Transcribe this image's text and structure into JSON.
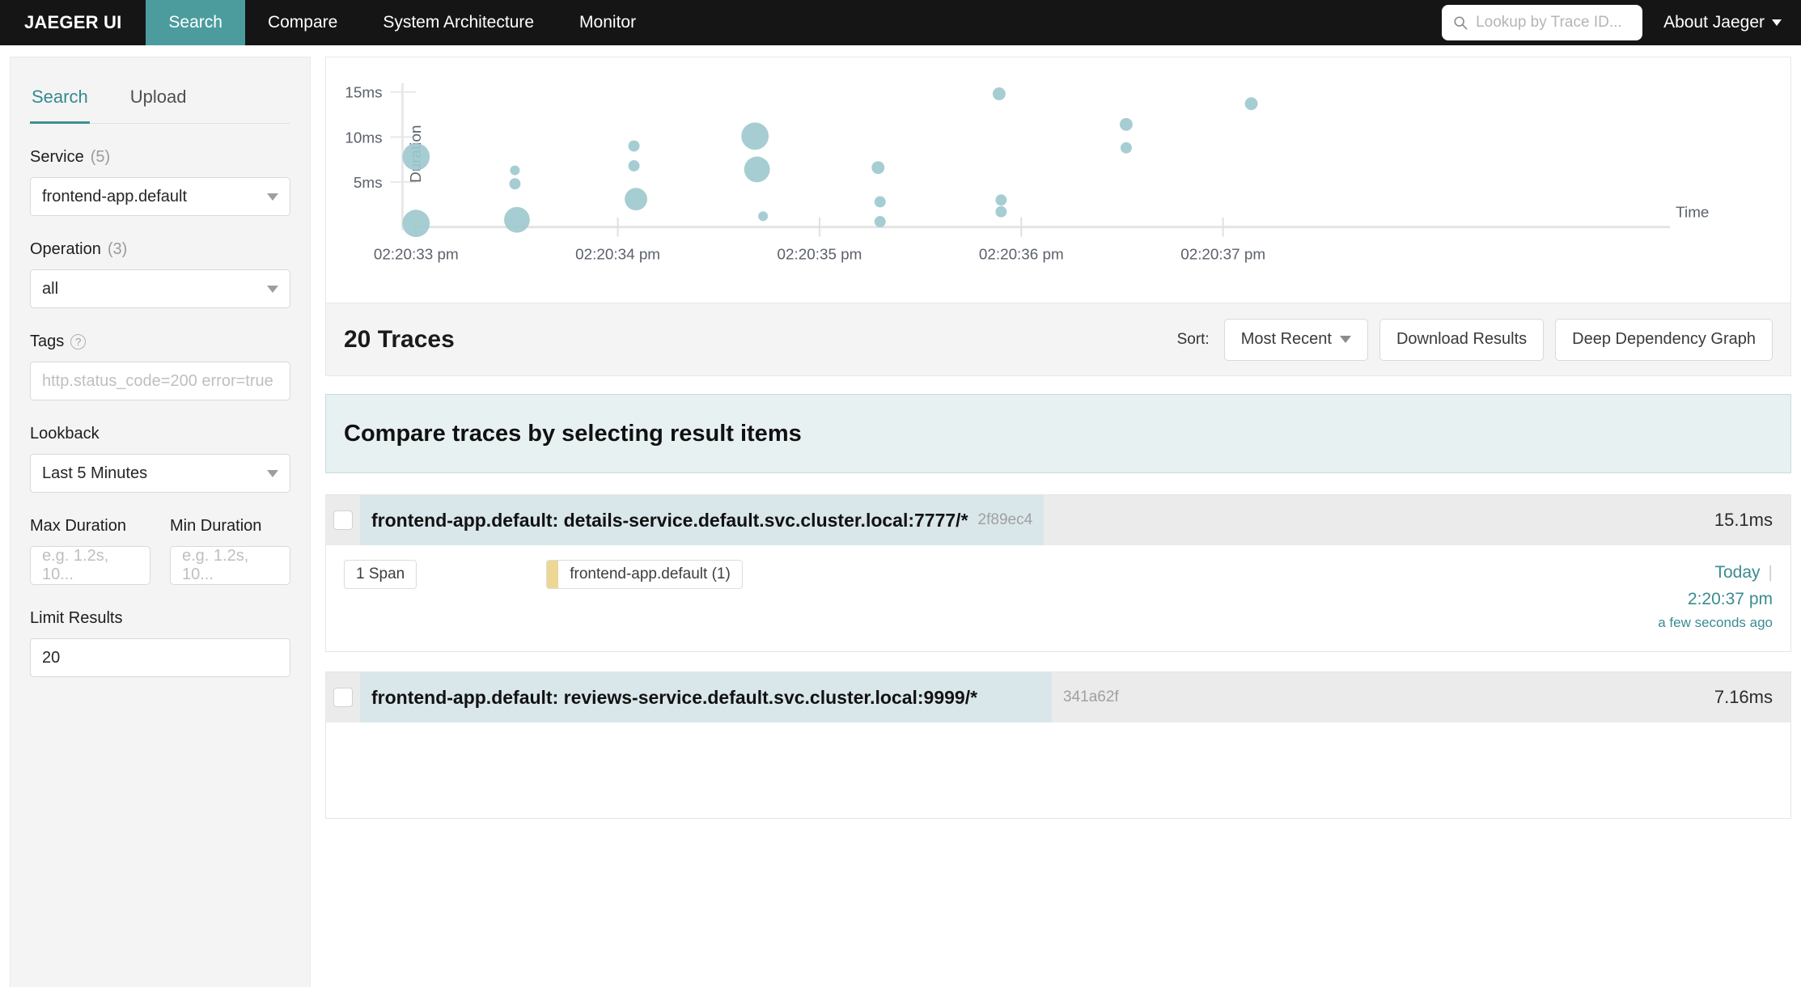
{
  "header": {
    "brand": "JAEGER UI",
    "nav": [
      {
        "label": "Search",
        "active": true
      },
      {
        "label": "Compare",
        "active": false
      },
      {
        "label": "System Architecture",
        "active": false
      },
      {
        "label": "Monitor",
        "active": false
      }
    ],
    "search_placeholder": "Lookup by Trace ID...",
    "search_value": "",
    "search_icon": "search-icon",
    "about_label": "About Jaeger"
  },
  "sidebar": {
    "tabs": [
      {
        "label": "Search",
        "active": true
      },
      {
        "label": "Upload",
        "active": false
      }
    ],
    "service": {
      "label": "Service",
      "count": "(5)",
      "value": "frontend-app.default"
    },
    "operation": {
      "label": "Operation",
      "count": "(3)",
      "value": "all"
    },
    "tags": {
      "label": "Tags",
      "help": "?",
      "value": "",
      "placeholder": "http.status_code=200 error=true"
    },
    "lookback": {
      "label": "Lookback",
      "value": "Last 5 Minutes"
    },
    "max_duration": {
      "label": "Max Duration",
      "value": "",
      "placeholder": "e.g. 1.2s, 10..."
    },
    "min_duration": {
      "label": "Min Duration",
      "value": "",
      "placeholder": "e.g. 1.2s, 10..."
    },
    "limit_results": {
      "label": "Limit Results",
      "value": "20"
    }
  },
  "results": {
    "count_label": "20 Traces",
    "sort_label": "Sort:",
    "sort_value": "Most Recent",
    "download_label": "Download Results",
    "ddg_label": "Deep Dependency Graph",
    "compare_banner": "Compare traces by selecting result items"
  },
  "traces": [
    {
      "title": "frontend-app.default: details-service.default.svc.cluster.local:7777/*",
      "trace_id": "2f89ec4",
      "duration": "15.1ms",
      "span_count": "1 Span",
      "service_pill": "frontend-app.default (1)",
      "service_color": "#eed695",
      "day": "Today",
      "time": "2:20:37 pm",
      "relative": "a few seconds ago"
    },
    {
      "title": "frontend-app.default: reviews-service.default.svc.cluster.local:9999/*",
      "trace_id": "341a62f",
      "duration": "7.16ms",
      "span_count": "",
      "service_pill": "",
      "service_color": "#eed695",
      "day": "",
      "time": "",
      "relative": ""
    }
  ],
  "colors": {
    "accent_teal": "#4c9c9e",
    "link_teal": "#3a8c90",
    "dot_fill": "#9ec9ce",
    "nav_bg": "#151515",
    "banner_bg": "#e8f1f2",
    "row_highlight": "#d9e7eb"
  },
  "chart_data": {
    "type": "scatter",
    "title": "",
    "xlabel": "Time",
    "ylabel": "Duration",
    "x_tick_labels": [
      "02:20:33 pm",
      "02:20:34 pm",
      "02:20:35 pm",
      "02:20:36 pm",
      "02:20:37 pm"
    ],
    "y_tick_labels": [
      "5ms",
      "10ms",
      "15ms"
    ],
    "y_ticks": [
      5,
      10,
      15
    ],
    "ylim": [
      0,
      16.5
    ],
    "xlim": [
      0,
      5.2
    ],
    "grid": false,
    "legend": null,
    "point_color": "#9ec9ce",
    "points": [
      {
        "x": 0.0,
        "y": 7.8,
        "r": 17,
        "label": ""
      },
      {
        "x": 0.0,
        "y": 0.4,
        "r": 17,
        "label": ""
      },
      {
        "x": 0.49,
        "y": 6.3,
        "r": 6,
        "label": ""
      },
      {
        "x": 0.49,
        "y": 4.8,
        "r": 7,
        "label": ""
      },
      {
        "x": 0.5,
        "y": 0.8,
        "r": 16,
        "label": ""
      },
      {
        "x": 1.08,
        "y": 9.0,
        "r": 7,
        "label": ""
      },
      {
        "x": 1.08,
        "y": 6.8,
        "r": 7,
        "label": ""
      },
      {
        "x": 1.09,
        "y": 3.1,
        "r": 14,
        "label": ""
      },
      {
        "x": 1.68,
        "y": 10.1,
        "r": 17,
        "label": ""
      },
      {
        "x": 1.69,
        "y": 6.4,
        "r": 16,
        "label": ""
      },
      {
        "x": 1.72,
        "y": 1.2,
        "r": 6,
        "label": ""
      },
      {
        "x": 2.29,
        "y": 6.6,
        "r": 8,
        "label": ""
      },
      {
        "x": 2.3,
        "y": 2.8,
        "r": 7,
        "label": ""
      },
      {
        "x": 2.3,
        "y": 0.6,
        "r": 7,
        "label": ""
      },
      {
        "x": 2.89,
        "y": 14.8,
        "r": 8,
        "label": ""
      },
      {
        "x": 2.9,
        "y": 3.0,
        "r": 7,
        "label": ""
      },
      {
        "x": 2.9,
        "y": 1.7,
        "r": 7,
        "label": ""
      },
      {
        "x": 3.52,
        "y": 11.4,
        "r": 8,
        "label": ""
      },
      {
        "x": 3.52,
        "y": 8.8,
        "r": 7,
        "label": ""
      },
      {
        "x": 4.14,
        "y": 13.7,
        "r": 8,
        "label": ""
      }
    ]
  }
}
